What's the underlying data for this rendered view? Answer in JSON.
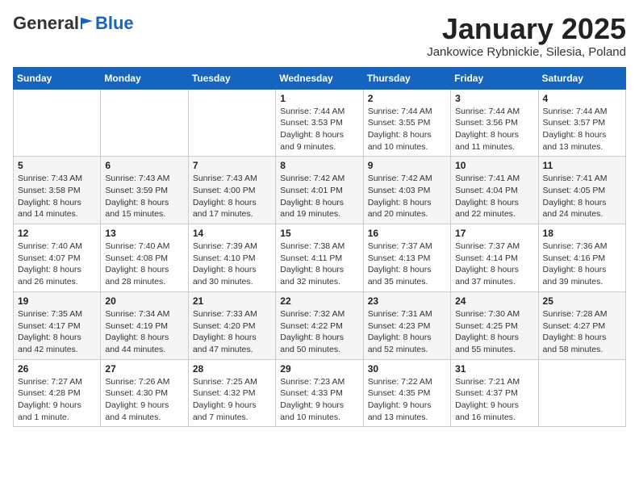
{
  "logo": {
    "general": "General",
    "blue": "Blue"
  },
  "header": {
    "title": "January 2025",
    "subtitle": "Jankowice Rybnickie, Silesia, Poland"
  },
  "weekdays": [
    "Sunday",
    "Monday",
    "Tuesday",
    "Wednesday",
    "Thursday",
    "Friday",
    "Saturday"
  ],
  "weeks": [
    [
      {
        "day": "",
        "info": ""
      },
      {
        "day": "",
        "info": ""
      },
      {
        "day": "",
        "info": ""
      },
      {
        "day": "1",
        "info": "Sunrise: 7:44 AM\nSunset: 3:53 PM\nDaylight: 8 hours\nand 9 minutes."
      },
      {
        "day": "2",
        "info": "Sunrise: 7:44 AM\nSunset: 3:55 PM\nDaylight: 8 hours\nand 10 minutes."
      },
      {
        "day": "3",
        "info": "Sunrise: 7:44 AM\nSunset: 3:56 PM\nDaylight: 8 hours\nand 11 minutes."
      },
      {
        "day": "4",
        "info": "Sunrise: 7:44 AM\nSunset: 3:57 PM\nDaylight: 8 hours\nand 13 minutes."
      }
    ],
    [
      {
        "day": "5",
        "info": "Sunrise: 7:43 AM\nSunset: 3:58 PM\nDaylight: 8 hours\nand 14 minutes."
      },
      {
        "day": "6",
        "info": "Sunrise: 7:43 AM\nSunset: 3:59 PM\nDaylight: 8 hours\nand 15 minutes."
      },
      {
        "day": "7",
        "info": "Sunrise: 7:43 AM\nSunset: 4:00 PM\nDaylight: 8 hours\nand 17 minutes."
      },
      {
        "day": "8",
        "info": "Sunrise: 7:42 AM\nSunset: 4:01 PM\nDaylight: 8 hours\nand 19 minutes."
      },
      {
        "day": "9",
        "info": "Sunrise: 7:42 AM\nSunset: 4:03 PM\nDaylight: 8 hours\nand 20 minutes."
      },
      {
        "day": "10",
        "info": "Sunrise: 7:41 AM\nSunset: 4:04 PM\nDaylight: 8 hours\nand 22 minutes."
      },
      {
        "day": "11",
        "info": "Sunrise: 7:41 AM\nSunset: 4:05 PM\nDaylight: 8 hours\nand 24 minutes."
      }
    ],
    [
      {
        "day": "12",
        "info": "Sunrise: 7:40 AM\nSunset: 4:07 PM\nDaylight: 8 hours\nand 26 minutes."
      },
      {
        "day": "13",
        "info": "Sunrise: 7:40 AM\nSunset: 4:08 PM\nDaylight: 8 hours\nand 28 minutes."
      },
      {
        "day": "14",
        "info": "Sunrise: 7:39 AM\nSunset: 4:10 PM\nDaylight: 8 hours\nand 30 minutes."
      },
      {
        "day": "15",
        "info": "Sunrise: 7:38 AM\nSunset: 4:11 PM\nDaylight: 8 hours\nand 32 minutes."
      },
      {
        "day": "16",
        "info": "Sunrise: 7:37 AM\nSunset: 4:13 PM\nDaylight: 8 hours\nand 35 minutes."
      },
      {
        "day": "17",
        "info": "Sunrise: 7:37 AM\nSunset: 4:14 PM\nDaylight: 8 hours\nand 37 minutes."
      },
      {
        "day": "18",
        "info": "Sunrise: 7:36 AM\nSunset: 4:16 PM\nDaylight: 8 hours\nand 39 minutes."
      }
    ],
    [
      {
        "day": "19",
        "info": "Sunrise: 7:35 AM\nSunset: 4:17 PM\nDaylight: 8 hours\nand 42 minutes."
      },
      {
        "day": "20",
        "info": "Sunrise: 7:34 AM\nSunset: 4:19 PM\nDaylight: 8 hours\nand 44 minutes."
      },
      {
        "day": "21",
        "info": "Sunrise: 7:33 AM\nSunset: 4:20 PM\nDaylight: 8 hours\nand 47 minutes."
      },
      {
        "day": "22",
        "info": "Sunrise: 7:32 AM\nSunset: 4:22 PM\nDaylight: 8 hours\nand 50 minutes."
      },
      {
        "day": "23",
        "info": "Sunrise: 7:31 AM\nSunset: 4:23 PM\nDaylight: 8 hours\nand 52 minutes."
      },
      {
        "day": "24",
        "info": "Sunrise: 7:30 AM\nSunset: 4:25 PM\nDaylight: 8 hours\nand 55 minutes."
      },
      {
        "day": "25",
        "info": "Sunrise: 7:28 AM\nSunset: 4:27 PM\nDaylight: 8 hours\nand 58 minutes."
      }
    ],
    [
      {
        "day": "26",
        "info": "Sunrise: 7:27 AM\nSunset: 4:28 PM\nDaylight: 9 hours\nand 1 minute."
      },
      {
        "day": "27",
        "info": "Sunrise: 7:26 AM\nSunset: 4:30 PM\nDaylight: 9 hours\nand 4 minutes."
      },
      {
        "day": "28",
        "info": "Sunrise: 7:25 AM\nSunset: 4:32 PM\nDaylight: 9 hours\nand 7 minutes."
      },
      {
        "day": "29",
        "info": "Sunrise: 7:23 AM\nSunset: 4:33 PM\nDaylight: 9 hours\nand 10 minutes."
      },
      {
        "day": "30",
        "info": "Sunrise: 7:22 AM\nSunset: 4:35 PM\nDaylight: 9 hours\nand 13 minutes."
      },
      {
        "day": "31",
        "info": "Sunrise: 7:21 AM\nSunset: 4:37 PM\nDaylight: 9 hours\nand 16 minutes."
      },
      {
        "day": "",
        "info": ""
      }
    ]
  ]
}
